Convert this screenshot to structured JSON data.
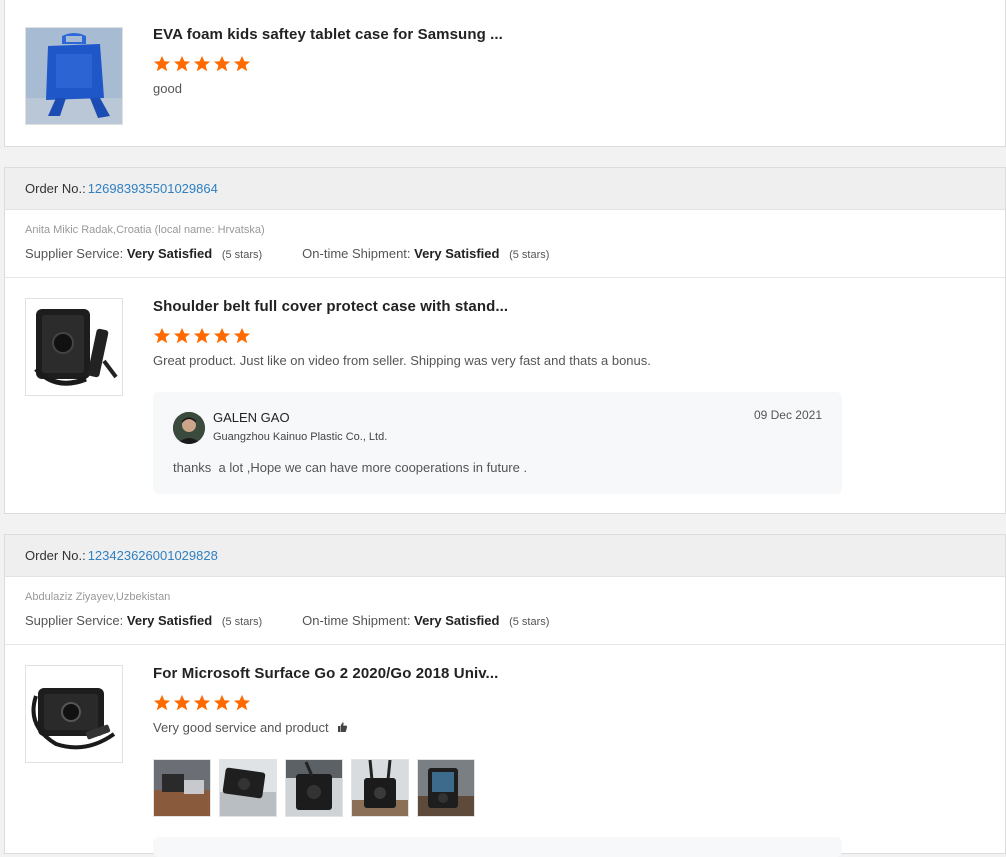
{
  "colors": {
    "star": "#ff6a00",
    "link": "#2f7fc1",
    "order_bar": "#efefef"
  },
  "reviews": [
    {
      "product_title": "EVA foam kids saftey tablet case for Samsung ...",
      "stars": 5,
      "text": "good",
      "image_icon": "blue-eva-tablet-case-icon"
    },
    {
      "order_label": "Order No.:",
      "order_number": "126983935501029864",
      "buyer": "Anita Mikic Radak,Croatia (local name: Hrvatska)",
      "supplier_label": "Supplier Service:",
      "supplier_value": "Very Satisfied",
      "supplier_stars": "(5 stars)",
      "shipment_label": "On-time Shipment:",
      "shipment_value": "Very Satisfied",
      "shipment_stars": "(5 stars)",
      "product_title": "Shoulder belt full cover protect case with stand...",
      "stars": 5,
      "text": "Great product. Just like on video from seller. Shipping was very fast and thats a bonus.",
      "image_icon": "black-shoulder-belt-case-icon",
      "reply": {
        "name": "GALEN GAO",
        "company": "Guangzhou Kainuo Plastic Co., Ltd.",
        "date": "09 Dec 2021",
        "text": "thanks  a lot ,Hope we can have more cooperations in future ."
      }
    },
    {
      "order_label": "Order No.:",
      "order_number": "123423626001029828",
      "buyer": "Abdulaziz Ziyayev,Uzbekistan",
      "supplier_label": "Supplier Service:",
      "supplier_value": "Very Satisfied",
      "supplier_stars": "(5 stars)",
      "shipment_label": "On-time Shipment:",
      "shipment_value": "Very Satisfied",
      "shipment_stars": "(5 stars)",
      "product_title": "For Microsoft Surface Go 2 2020/Go 2018 Univ...",
      "stars": 5,
      "text": "Very good service and product",
      "emoji_icon": "thumbs-up-icon",
      "image_icon": "black-rotating-case-strap-icon",
      "photos": [
        "review-photo-1",
        "review-photo-2",
        "review-photo-3",
        "review-photo-4",
        "review-photo-5"
      ]
    }
  ]
}
